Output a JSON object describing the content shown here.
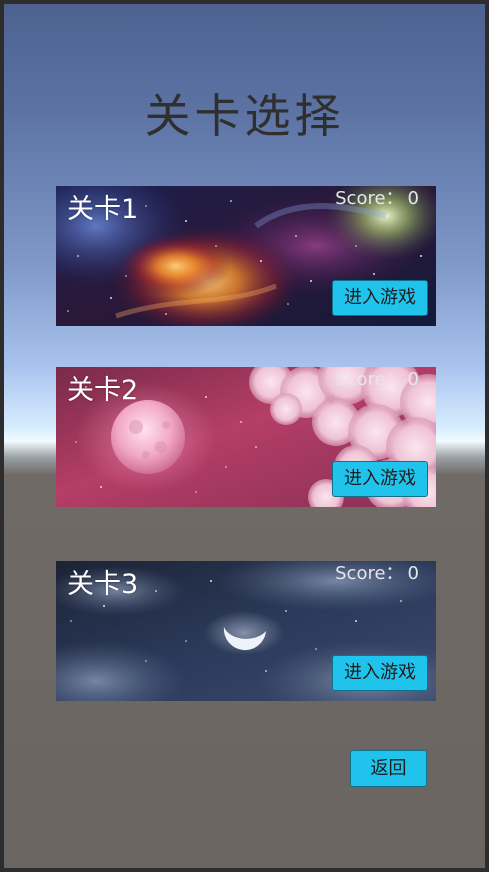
{
  "screen": {
    "title": "关卡选择"
  },
  "levels": [
    {
      "name": "关卡1",
      "score_label": "Score：",
      "score": "0",
      "enter_label": "进入游戏",
      "theme": "galaxy-nebula"
    },
    {
      "name": "关卡2",
      "score_label": "Score：",
      "score": "0",
      "enter_label": "进入游戏",
      "theme": "pink-moon-clouds"
    },
    {
      "name": "关卡3",
      "score_label": "Score：",
      "score": "0",
      "enter_label": "进入游戏",
      "theme": "night-sky-crescent"
    }
  ],
  "back_label": "返回",
  "colors": {
    "button": "#1fc3ec",
    "button_border": "#11718a",
    "title_text": "#2f2f2f",
    "frame": "#2d2d2d",
    "ground": "#6b6561"
  }
}
